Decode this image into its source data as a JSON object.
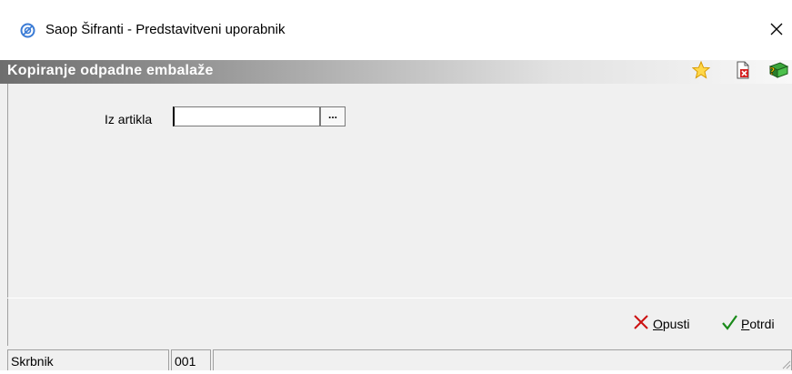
{
  "window": {
    "title": "Saop Šifranti - Predstavitveni uporabnik",
    "close_glyph": "✕"
  },
  "header": {
    "title": "Kopiranje odpadne embalaže",
    "icons": [
      "star-icon",
      "document-close-icon",
      "help-book-icon"
    ]
  },
  "form": {
    "field_label": "Iz artikla",
    "field_value": "",
    "lookup_button_label": "..."
  },
  "actions": {
    "cancel_label": "Opusti",
    "confirm_label": "Potrdi"
  },
  "status": {
    "owner": "Skrbnik",
    "code": "001",
    "extra": ""
  },
  "colors": {
    "header_gradient_start": "#6e6e6e",
    "header_gradient_end": "#f8f8f8",
    "cancel_icon": "#cc1111",
    "confirm_icon": "#1a8a1a",
    "star": "#f5b400"
  }
}
